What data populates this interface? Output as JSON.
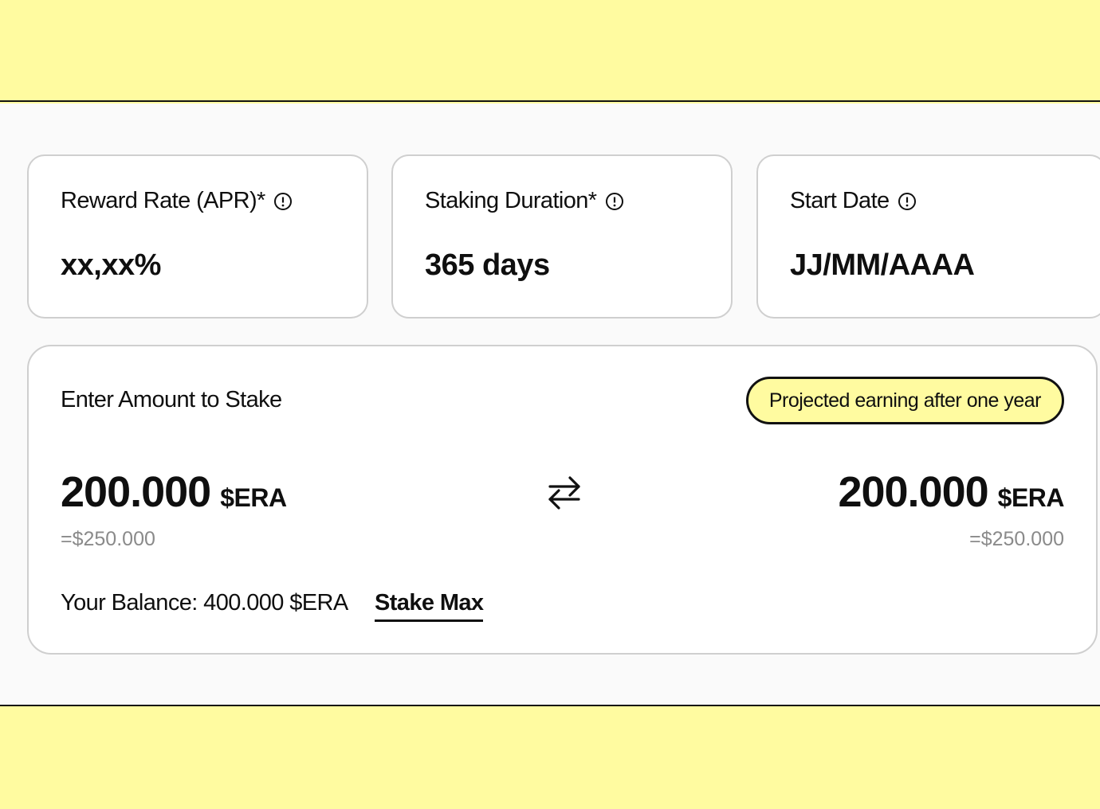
{
  "stats": {
    "reward_rate": {
      "label": "Reward Rate (APR)*",
      "value": "xx,xx%",
      "icon": "info-icon"
    },
    "staking_duration": {
      "label": "Staking Duration*",
      "value": "365 days",
      "icon": "info-icon"
    },
    "start_date": {
      "label": "Start Date",
      "value": "JJ/MM/AAAA",
      "icon": "info-icon"
    }
  },
  "stake": {
    "title": "Enter Amount to Stake",
    "projected_label": "Projected earning after one year",
    "input": {
      "amount": "200.000",
      "token": "$ERA",
      "usd": "=$250.000"
    },
    "output": {
      "amount": "200.000",
      "token": "$ERA",
      "usd": "=$250.000"
    },
    "swap_icon": "swap-arrows-icon",
    "balance": "Your Balance: 400.000 $ERA",
    "stake_max_label": "Stake Max"
  },
  "colors": {
    "accent": "#fffba0",
    "border": "#cfcfcf",
    "muted_text": "#8a8a8a",
    "text": "#0f0f0f"
  }
}
